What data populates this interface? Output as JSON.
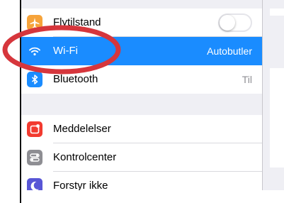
{
  "settings": {
    "rows": [
      {
        "label": "Flytilstand",
        "value": "",
        "icon": "airplane-icon",
        "icon_color": "#f6a33a"
      },
      {
        "label": "Wi-Fi",
        "value": "Autobutler",
        "icon": "wifi-icon",
        "icon_color": "#1a8cff"
      },
      {
        "label": "Bluetooth",
        "value": "Til",
        "icon": "bluetooth-icon",
        "icon_color": "#1a8cff"
      },
      {
        "label": "Meddelelser",
        "value": "",
        "icon": "notifications-icon",
        "icon_color": "#f23a2f"
      },
      {
        "label": "Kontrolcenter",
        "value": "",
        "icon": "control-center-icon",
        "icon_color": "#8e8e93"
      },
      {
        "label": "Forstyr ikke",
        "value": "",
        "icon": "moon-icon",
        "icon_color": "#5856d6"
      }
    ],
    "selected_row": "Wi-Fi",
    "airplane_mode_on": false
  },
  "colors": {
    "selection": "#1a8cff",
    "annotation_circle": "#d6363c",
    "panel_background": "#efeff4"
  }
}
